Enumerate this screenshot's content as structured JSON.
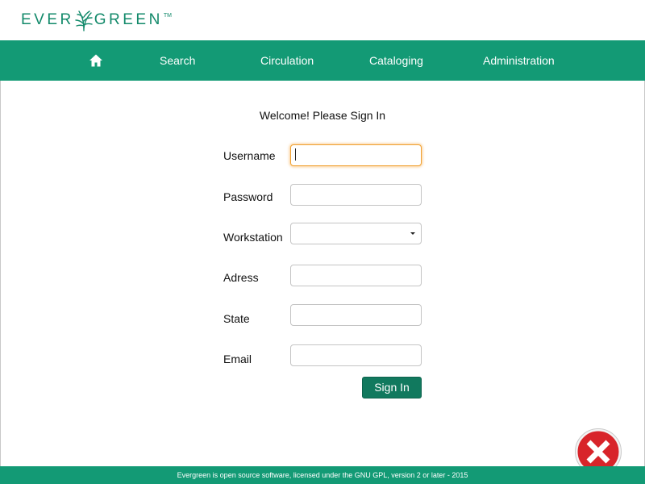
{
  "brand": {
    "logo_left": "EVER",
    "logo_right": "GREEN",
    "logo_tm": "TM",
    "color": "#12896a"
  },
  "nav": {
    "home_icon": "home-icon",
    "items": [
      {
        "label": "Search"
      },
      {
        "label": "Circulation"
      },
      {
        "label": "Cataloging"
      },
      {
        "label": "Administration"
      }
    ],
    "background": "#139a75"
  },
  "login": {
    "title": "Welcome! Please Sign In",
    "fields": {
      "username": {
        "label": "Username",
        "value": ""
      },
      "password": {
        "label": "Password",
        "value": ""
      },
      "workstation": {
        "label": "Workstation",
        "value": ""
      },
      "address": {
        "label": "Adress",
        "value": ""
      },
      "state": {
        "label": "State",
        "value": ""
      },
      "email": {
        "label": "Email",
        "value": ""
      }
    },
    "submit_label": "Sign In"
  },
  "overlay": {
    "close_icon": "close-icon"
  },
  "footer": {
    "text": "Evergreen is open source software, licensed under the GNU GPL, version 2 or later - 2015"
  }
}
